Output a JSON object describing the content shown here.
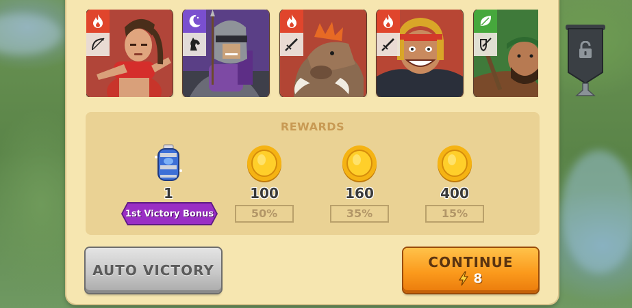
{
  "heroes": [
    {
      "element": "fire",
      "element_icon": "flame-icon",
      "class_icon": "bow-icon",
      "element_color": "#e0452c"
    },
    {
      "element": "moon",
      "element_icon": "crescent-moon-icon",
      "class_icon": "horse-icon",
      "element_color": "#7a4fcf"
    },
    {
      "element": "fire",
      "element_icon": "flame-icon",
      "class_icon": "sword-icon",
      "element_color": "#e0452c"
    },
    {
      "element": "fire",
      "element_icon": "flame-icon",
      "class_icon": "sword-icon",
      "element_color": "#e0452c"
    },
    {
      "element": "nature",
      "element_icon": "leaf-icon",
      "class_icon": "shield-sword-icon",
      "element_color": "#46a83c"
    }
  ],
  "rewards": {
    "title": "REWARDS",
    "items": [
      {
        "icon": "potion-barrel-icon",
        "amount": "1",
        "bonus_label": "1st Victory Bonus"
      },
      {
        "icon": "gold-coin-icon",
        "amount": "100",
        "chance": "50%"
      },
      {
        "icon": "gold-coin-icon",
        "amount": "160",
        "chance": "35%"
      },
      {
        "icon": "gold-coin-icon",
        "amount": "400",
        "chance": "15%"
      }
    ]
  },
  "buttons": {
    "auto_victory": "AUTO VICTORY",
    "continue": "CONTINUE",
    "continue_cost": "8",
    "continue_cost_icon": "lightning-icon"
  },
  "side": {
    "lock_icon": "padlock-icon"
  },
  "colors": {
    "panel": "#f6e6b0",
    "rewards_box": "#ead294",
    "continue_button": "#fb9a1c",
    "auto_button": "#c8c8c8",
    "bonus_tag": "#9a2fc4"
  }
}
